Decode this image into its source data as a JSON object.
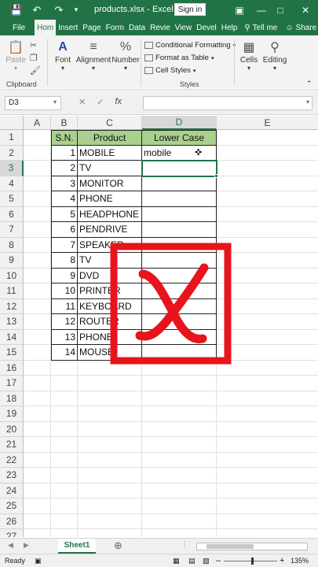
{
  "app": {
    "title": "products.xlsx - Excel",
    "sign_in": "Sign in",
    "accent": "#217346"
  },
  "tabs": [
    "File",
    "Hom",
    "Insert",
    "Page",
    "Form",
    "Data",
    "Revie",
    "View",
    "Devel",
    "Help"
  ],
  "tell_me": "Tell me",
  "share": "Share",
  "ribbon": {
    "paste": "Paste",
    "clipboard": "Clipboard",
    "font": "Font",
    "alignment": "Alignment",
    "number": "Number",
    "conditional_formatting": "Conditional Formatting",
    "format_as_table": "Format as Table",
    "cell_styles": "Cell Styles",
    "styles": "Styles",
    "cells": "Cells",
    "editing": "Editing"
  },
  "formula_bar": {
    "name_box": "D3",
    "formula": ""
  },
  "grid": {
    "columns": [
      "A",
      "B",
      "C",
      "D",
      "E"
    ],
    "selected_column": "D",
    "selected_row": 3,
    "header": {
      "sn": "S.N.",
      "product": "Product",
      "lower_case": "Lower Case"
    },
    "rows": [
      {
        "sn": "1",
        "product": "MOBILE",
        "lower": "mobile"
      },
      {
        "sn": "2",
        "product": "TV",
        "lower": ""
      },
      {
        "sn": "3",
        "product": "MONITOR",
        "lower": ""
      },
      {
        "sn": "4",
        "product": "PHONE",
        "lower": ""
      },
      {
        "sn": "5",
        "product": "HEADPHONE",
        "lower": ""
      },
      {
        "sn": "6",
        "product": "PENDRIVE",
        "lower": ""
      },
      {
        "sn": "7",
        "product": "SPEAKER",
        "lower": ""
      },
      {
        "sn": "8",
        "product": "TV",
        "lower": ""
      },
      {
        "sn": "9",
        "product": "DVD",
        "lower": ""
      },
      {
        "sn": "10",
        "product": "PRINTER",
        "lower": ""
      },
      {
        "sn": "11",
        "product": "KEYBOARD",
        "lower": ""
      },
      {
        "sn": "12",
        "product": "ROUTER",
        "lower": ""
      },
      {
        "sn": "13",
        "product": "PHONE",
        "lower": ""
      },
      {
        "sn": "14",
        "product": "MOUSE",
        "lower": ""
      }
    ],
    "row_numbers": [
      "1",
      "2",
      "3",
      "4",
      "5",
      "6",
      "7",
      "8",
      "9",
      "10",
      "11",
      "12",
      "13",
      "14",
      "15",
      "16",
      "17",
      "18",
      "19",
      "20",
      "21",
      "22",
      "23",
      "24",
      "25",
      "26",
      "27"
    ]
  },
  "sheet": {
    "name": "Sheet1"
  },
  "status": {
    "ready": "Ready",
    "zoom": "135%"
  },
  "overlay": {
    "icon": "red-x-icon",
    "color": "#e8141b"
  }
}
